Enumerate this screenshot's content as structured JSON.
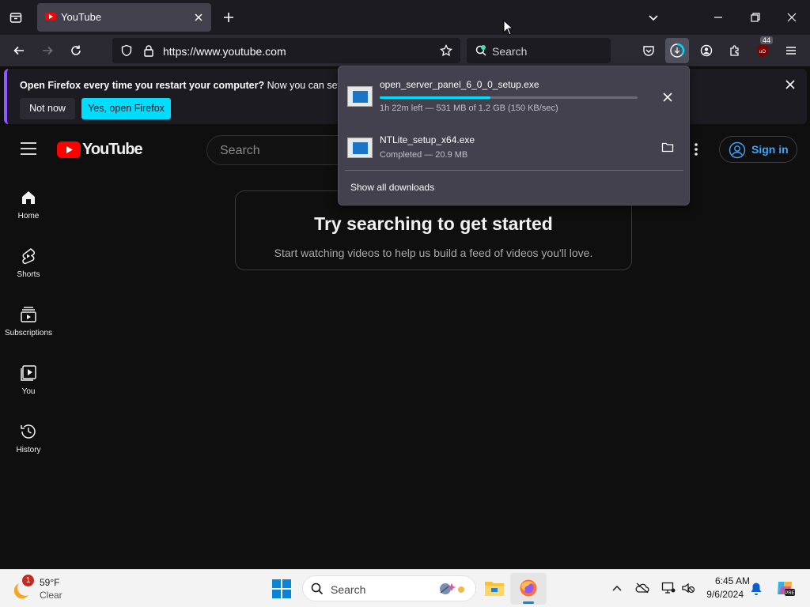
{
  "browser": {
    "tab": {
      "title": "YouTube"
    },
    "url": "https://www.youtube.com",
    "search_placeholder": "Search",
    "extension_badge": "44"
  },
  "notification": {
    "bold": "Open Firefox every time you restart your computer?",
    "text": " Now you can set Fire",
    "not_now": "Not now",
    "yes": "Yes, open Firefox"
  },
  "youtube": {
    "logo": "YouTube",
    "search_placeholder": "Search",
    "sign_in": "Sign in",
    "sidebar": [
      {
        "label": "Home",
        "icon": "home-icon"
      },
      {
        "label": "Shorts",
        "icon": "shorts-icon"
      },
      {
        "label": "Subscriptions",
        "icon": "subscriptions-icon"
      },
      {
        "label": "You",
        "icon": "you-icon"
      },
      {
        "label": "History",
        "icon": "history-icon"
      }
    ],
    "empty_title": "Try searching to get started",
    "empty_sub": "Start watching videos to help us build a feed of videos you'll love."
  },
  "downloads": {
    "items": [
      {
        "name": "open_server_panel_6_0_0_setup.exe",
        "status": "1h 22m left — 531 MB of 1.2 GB (150 KB/sec)",
        "progress": 0.43
      },
      {
        "name": "NTLite_setup_x64.exe",
        "status": "Completed — 20.9 MB"
      }
    ],
    "show_all": "Show all downloads"
  },
  "taskbar": {
    "weather_temp": "59°F",
    "weather_desc": "Clear",
    "weather_badge": "1",
    "search": "Search",
    "time": "6:45 AM",
    "date": "9/6/2024"
  },
  "colors": {
    "accent": "#00ddff",
    "yt_red": "#ff0000",
    "signin": "#3ea6ff"
  }
}
